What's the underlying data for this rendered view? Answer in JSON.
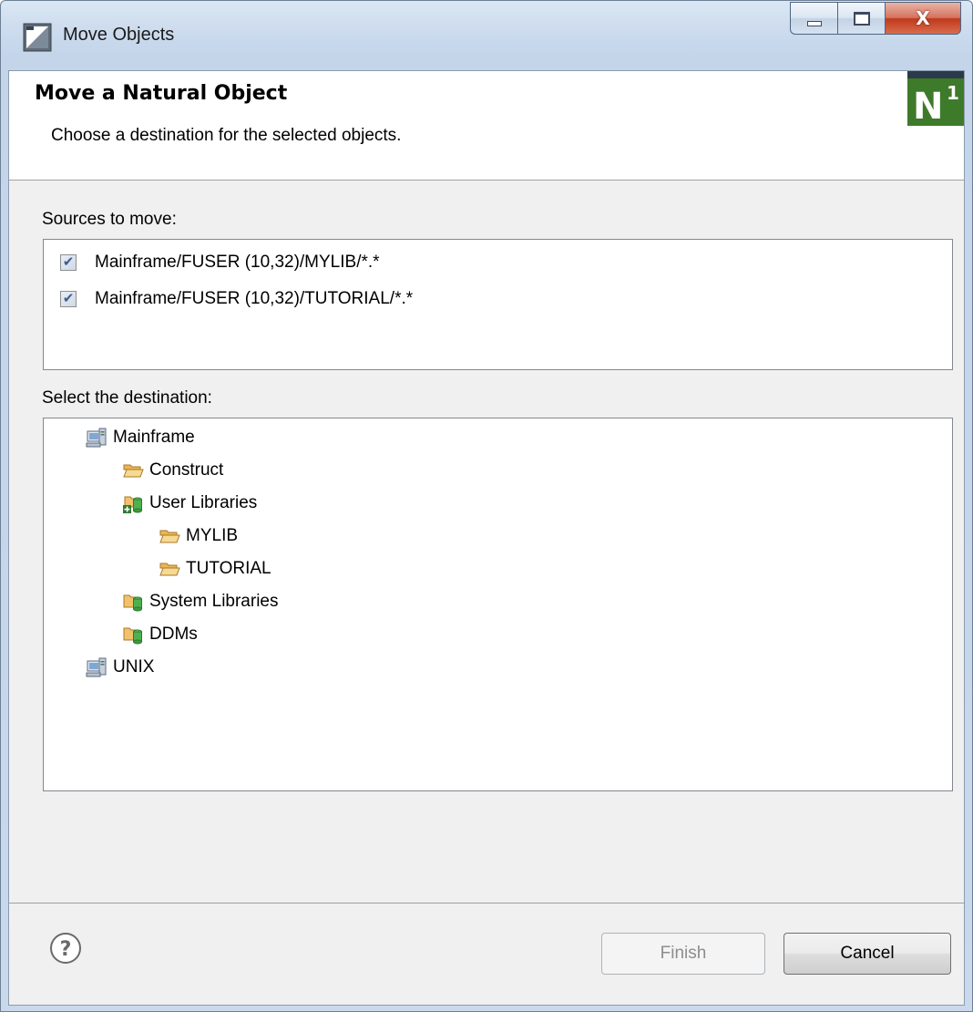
{
  "window": {
    "title": "Move Objects",
    "close_glyph": "X"
  },
  "header": {
    "title": "Move a Natural Object",
    "description": "Choose a destination for the selected objects.",
    "logo_letter": "N",
    "logo_superscript": "1"
  },
  "sources": {
    "label": "Sources to move:",
    "items": [
      {
        "label": "Mainframe/FUSER (10,32)/MYLIB/*.*",
        "checked": true
      },
      {
        "label": "Mainframe/FUSER (10,32)/TUTORIAL/*.*",
        "checked": true
      }
    ]
  },
  "destination": {
    "label": "Select the destination:",
    "tree": [
      {
        "label": "Mainframe",
        "icon": "server-icon",
        "depth": 0
      },
      {
        "label": "Construct",
        "icon": "folder-open-icon",
        "depth": 1
      },
      {
        "label": "User Libraries",
        "icon": "library-add-icon",
        "depth": 1
      },
      {
        "label": "MYLIB",
        "icon": "folder-open-icon",
        "depth": 2
      },
      {
        "label": "TUTORIAL",
        "icon": "folder-open-icon",
        "depth": 2
      },
      {
        "label": "System Libraries",
        "icon": "library-icon",
        "depth": 1
      },
      {
        "label": "DDMs",
        "icon": "library-icon",
        "depth": 1
      },
      {
        "label": "UNIX",
        "icon": "server-icon",
        "depth": 0
      }
    ]
  },
  "footer": {
    "finish_label": "Finish",
    "cancel_label": "Cancel",
    "finish_enabled": false
  },
  "colors": {
    "folder": "#f2c26b",
    "library_green": "#2e9a3e",
    "logo_green": "#3d7a2a"
  }
}
